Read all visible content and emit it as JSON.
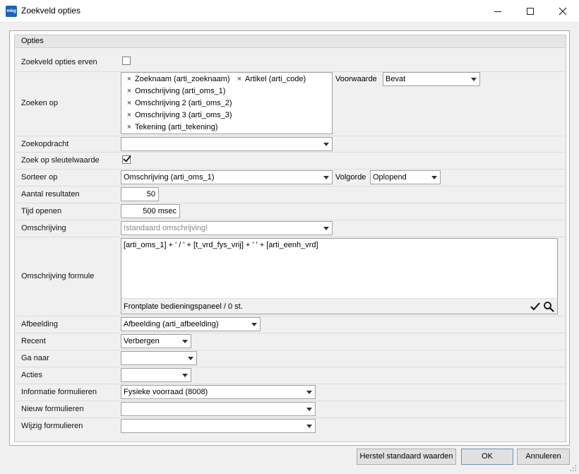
{
  "window": {
    "app_icon_text": "mkg",
    "title": "Zoekveld opties"
  },
  "section": {
    "title": "Opties"
  },
  "labels": {
    "inherit": "Zoekveld opties erven",
    "search_on": "Zoeken op",
    "search_command": "Zoekopdracht",
    "search_key": "Zoek op sleutelwaarde",
    "sort_on": "Sorteer op",
    "result_count": "Aantal resultaten",
    "open_time": "Tijd openen",
    "description": "Omschrijving",
    "description_formula": "Omschrijving formule",
    "image": "Afbeelding",
    "recent": "Recent",
    "goto": "Ga naar",
    "actions": "Acties",
    "info_forms": "Informatie formulieren",
    "new_forms": "Nieuw formulieren",
    "edit_forms": "Wijzig formulieren"
  },
  "search_on_tokens": [
    "Zoeknaam (arti_zoeknaam)",
    "Artikel (arti_code)",
    "Omschrijving (arti_oms_1)",
    "Omschrijving 2 (arti_oms_2)",
    "Omschrijving 3 (arti_oms_3)",
    "Tekening (arti_tekening)"
  ],
  "token_remove_glyph": "×",
  "condition": {
    "label": "Voorwaarde",
    "value": "Bevat"
  },
  "search_command_value": "",
  "sort": {
    "value": "Omschrijving (arti_oms_1)",
    "order_label": "Volgorde",
    "order_value": "Oplopend"
  },
  "result_count_value": "50",
  "open_time_value": "500 msec",
  "description_value": "!standaard omschrijving!",
  "formula": {
    "code": "[arti_oms_1] + ' /  ' + [t_vrd_fys_vrij] + ' ' + [arti_eenh_vrd]",
    "preview": "Frontplate bedieningspaneel /  0 st."
  },
  "image_value": "Afbeelding (arti_afbeelding)",
  "recent_value": "Verbergen",
  "goto_value": "",
  "actions_value": "",
  "info_forms_value": "Fysieke voorraad (8008)",
  "new_forms_value": "",
  "edit_forms_value": "",
  "checkboxes": {
    "inherit_checked": false,
    "search_key_checked": true
  },
  "buttons": {
    "reset": "Herstel standaard waarden",
    "ok": "OK",
    "cancel": "Annuleren"
  },
  "icons": {
    "app": "mkg-logo-icon",
    "minimize": "minimize-icon",
    "maximize": "maximize-icon",
    "close": "close-icon",
    "dropdown": "chevron-down-icon",
    "validate": "checkmark-icon",
    "search": "search-icon"
  },
  "colors": {
    "app_icon": "#1a63b8",
    "window_bg": "#f0f0f0",
    "field_bg": "#ffffff"
  }
}
